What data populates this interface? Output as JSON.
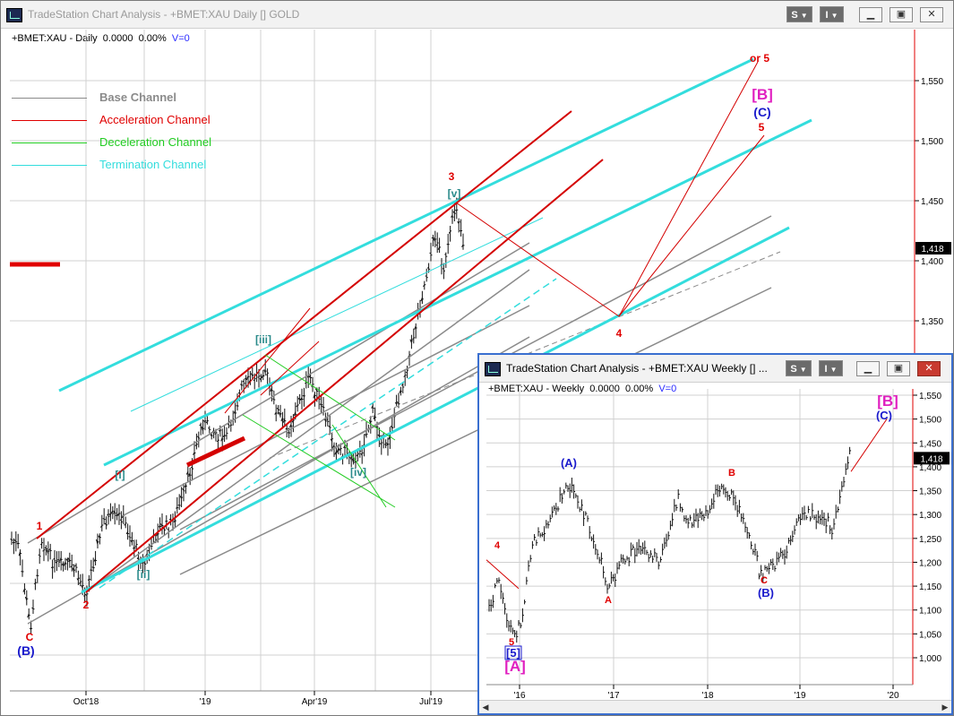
{
  "main_window": {
    "title": "TradeStation Chart Analysis - +BMET:XAU Daily [] GOLD",
    "s_button": "S",
    "i_button": "I",
    "header": {
      "symbol": "+BMET:XAU - Daily",
      "value": "0.0000",
      "change": "0.00%",
      "volume": "V=0"
    },
    "price_tag": "1,418",
    "y_ticks": [
      "1,550",
      "1,500",
      "1,450",
      "1,400",
      "1,350"
    ],
    "x_ticks": [
      "Oct'18",
      "'19",
      "Apr'19",
      "Jul'19"
    ],
    "legend": [
      {
        "label": "Base Channel",
        "color": "#8a8a8a"
      },
      {
        "label": "Acceleration Channel",
        "color": "#e00000"
      },
      {
        "label": "Deceleration Channel",
        "color": "#22cc22"
      },
      {
        "label": "Termination Channel",
        "color": "#33dddd"
      }
    ],
    "wave_labels": [
      {
        "text": "1",
        "color": "#e00000"
      },
      {
        "text": "2",
        "color": "#e00000"
      },
      {
        "text": "3",
        "color": "#e00000"
      },
      {
        "text": "4",
        "color": "#e00000"
      },
      {
        "text": "5",
        "color": "#e00000"
      },
      {
        "text": "or 5",
        "color": "#e00000"
      },
      {
        "text": "C",
        "color": "#e00000"
      },
      {
        "text": "(B)",
        "color": "#1a1acc"
      },
      {
        "text": "[i]",
        "color": "#2a8a8a"
      },
      {
        "text": "[ii]",
        "color": "#2a8a8a"
      },
      {
        "text": "[iii]",
        "color": "#2a8a8a"
      },
      {
        "text": "[iv]",
        "color": "#2a8a8a"
      },
      {
        "text": "[v]",
        "color": "#2a8a8a"
      },
      {
        "text": "[B]",
        "color": "#e020c0"
      },
      {
        "text": "(C)",
        "color": "#1a1acc"
      }
    ]
  },
  "weekly_window": {
    "title": "TradeStation Chart Analysis - +BMET:XAU Weekly [] ...",
    "s_button": "S",
    "i_button": "I",
    "header": {
      "symbol": "+BMET:XAU - Weekly",
      "value": "0.0000",
      "change": "0.00%",
      "volume": "V=0"
    },
    "price_tag": "1,418",
    "y_ticks": [
      "1,550",
      "1,500",
      "1,450",
      "1,400",
      "1,350",
      "1,300",
      "1,250",
      "1,200",
      "1,150",
      "1,100",
      "1,050",
      "1,000"
    ],
    "x_ticks": [
      "'16",
      "'17",
      "'18",
      "'19",
      "'20"
    ],
    "wave_labels": [
      {
        "text": "4",
        "color": "#e00000"
      },
      {
        "text": "5",
        "color": "#e00000"
      },
      {
        "text": "[5]",
        "color": "#1a1acc"
      },
      {
        "text": "[A]",
        "color": "#e020c0"
      },
      {
        "text": "(A)",
        "color": "#1a1acc"
      },
      {
        "text": "A",
        "color": "#e00000"
      },
      {
        "text": "B",
        "color": "#e00000"
      },
      {
        "text": "C",
        "color": "#e00000"
      },
      {
        "text": "(B)",
        "color": "#1a1acc"
      },
      {
        "text": "[B]",
        "color": "#e020c0"
      },
      {
        "text": "(C)",
        "color": "#1a1acc"
      }
    ]
  }
}
